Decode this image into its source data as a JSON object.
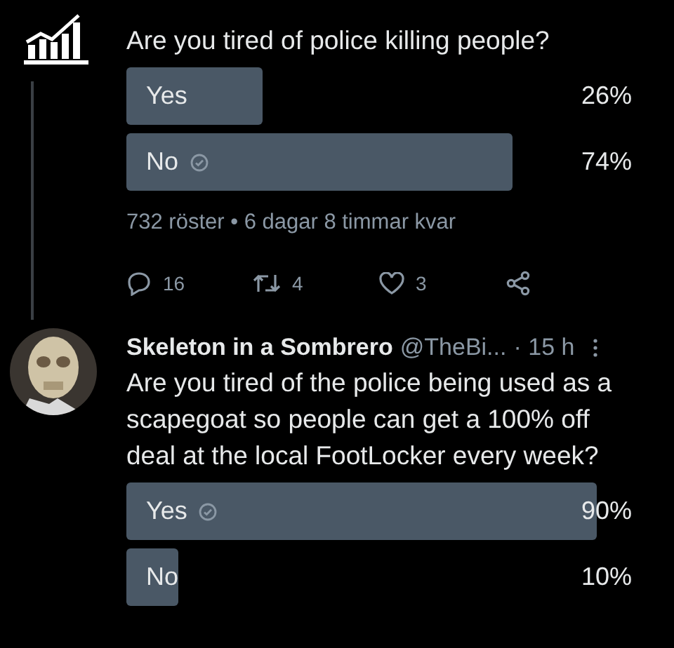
{
  "tweets": [
    {
      "kind": "poll-top",
      "question": "Are you tired of police killing people?",
      "options": [
        {
          "label": "Yes",
          "percent": "26%",
          "selected": false
        },
        {
          "label": "No",
          "percent": "74%",
          "selected": true
        }
      ],
      "meta": "732 röster • 6 dagar 8 timmar kvar",
      "actions": {
        "replies": "16",
        "retweets": "4",
        "likes": "3"
      }
    },
    {
      "kind": "reply",
      "author": "Skeleton in a Sombrero",
      "handle": "@TheBi...",
      "time": "· 15 h",
      "question": "Are you tired of the police being used as a scapegoat so people can get a 100% off deal at the local FootLocker every week?",
      "options": [
        {
          "label": "Yes",
          "percent": "90%",
          "selected": true
        },
        {
          "label": "No",
          "percent": "10%",
          "selected": false
        }
      ]
    }
  ]
}
